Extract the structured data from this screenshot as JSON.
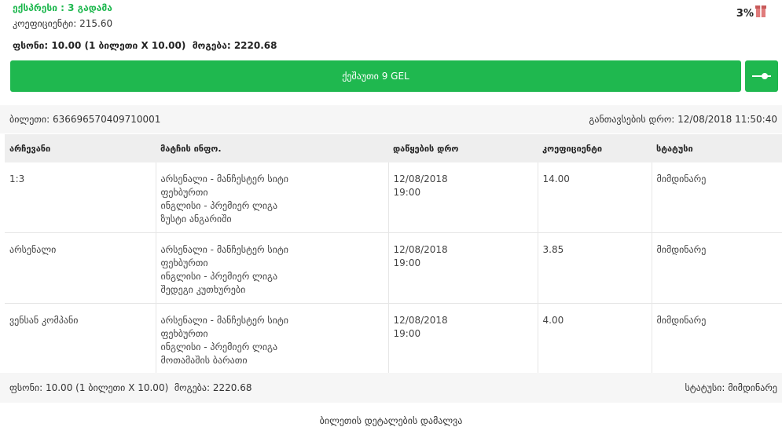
{
  "summary": {
    "title": "ექსპრესი : 3 გადამა",
    "coef_label": "კოეფიციენტი:",
    "coef_value": "215.60",
    "bonus_percent": "3%",
    "stake_label": "ფსონი:",
    "stake_value": "10.00 (1 ბილეთი X 10.00)",
    "win_label": "მოგება:",
    "win_value": "2220.68"
  },
  "actions": {
    "cashout_label": "ქეშაუთი 9 GEL"
  },
  "ticket": {
    "id_label": "ბილეთი:",
    "id_value": "636696570409710001",
    "time_label": "განთავსების დრო:",
    "time_value": "12/08/2018 11:50:40"
  },
  "table": {
    "headers": [
      "არჩევანი",
      "მატჩის ინფო.",
      "დაწყების დრო",
      "კოეფიციენტი",
      "სტატუსი"
    ],
    "rows": [
      {
        "selection": "1:3",
        "match": "არსენალი - მანჩესტერ სიტი",
        "sport": "ფეხბურთი",
        "league": "ინგლისი - პრემიერ ლიგა",
        "market": "ზუსტი ანგარიში",
        "date": "12/08/2018",
        "time": "19:00",
        "coef": "14.00",
        "status": "მიმდინარე"
      },
      {
        "selection": "არსენალი",
        "match": "არსენალი - მანჩესტერ სიტი",
        "sport": "ფეხბურთი",
        "league": "ინგლისი - პრემიერ ლიგა",
        "market": "შედეგი კუთხურები",
        "date": "12/08/2018",
        "time": "19:00",
        "coef": "3.85",
        "status": "მიმდინარე"
      },
      {
        "selection": "ვენსან კომპანი",
        "match": "არსენალი - მანჩესტერ სიტი",
        "sport": "ფეხბურთი",
        "league": "ინგლისი - პრემიერ ლიგა",
        "market": "მოთამაშის ბარათი",
        "date": "12/08/2018",
        "time": "19:00",
        "coef": "4.00",
        "status": "მიმდინარე"
      }
    ]
  },
  "footer": {
    "stake_label": "ფსონი:",
    "stake_value": "10.00 (1 ბილეთი X 10.00)",
    "win_label": "მოგება:",
    "win_value": "2220.68",
    "status_label": "სტატუსი:",
    "status_value": "მიმდინარე",
    "hide_details": "ბილეთის დეტალების დამალვა"
  },
  "colors": {
    "accent": "#1fb84f",
    "header_bg": "#eeeeee",
    "bar_bg": "#f6f6f6",
    "gift": "#e07c7c"
  },
  "icons": {
    "bonus": "gift-icon",
    "slider": "slider-toggle-icon"
  }
}
